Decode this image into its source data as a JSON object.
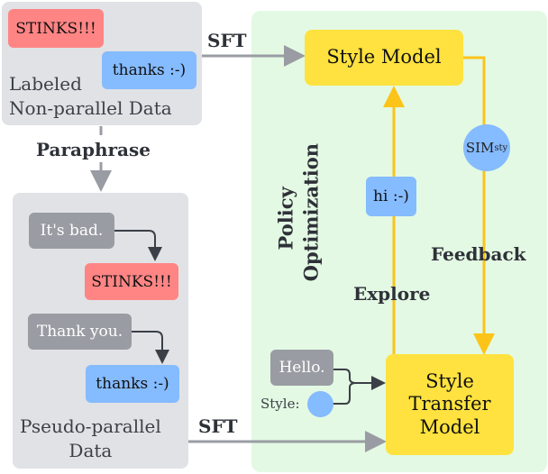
{
  "labeled_data": {
    "label_line1": "Labeled",
    "label_line2": "Non-parallel Data",
    "negative_example": "STINKS!!!",
    "positive_example": "thanks :-)"
  },
  "paraphrase_label": "Paraphrase",
  "pseudo_parallel": {
    "label_line1": "Pseudo-parallel",
    "label_line2": "Data",
    "pairs": [
      {
        "source": "It's bad.",
        "target": "STINKS!!!"
      },
      {
        "source": "Thank you.",
        "target": "thanks :-)"
      }
    ]
  },
  "sft_top": "SFT",
  "sft_bottom": "SFT",
  "policy_optimization": {
    "line1": "Policy",
    "line2": "Optimization"
  },
  "style_model": "Style Model",
  "style_transfer_model": {
    "line1": "Style",
    "line2": "Transfer",
    "line3": "Model"
  },
  "sim": {
    "base": "SIM",
    "sub": "sty"
  },
  "explore_label": "Explore",
  "feedback_label": "Feedback",
  "explore_output": "hi :-)",
  "input_text": "Hello.",
  "style_label": "Style:",
  "colors": {
    "negative": "#ff8585",
    "positive": "#85bbff",
    "model": "#ffe23f",
    "policy_bg": "#e3f9e3",
    "data_bg": "#e0e2e6",
    "rl_arrow": "#fcc419"
  }
}
